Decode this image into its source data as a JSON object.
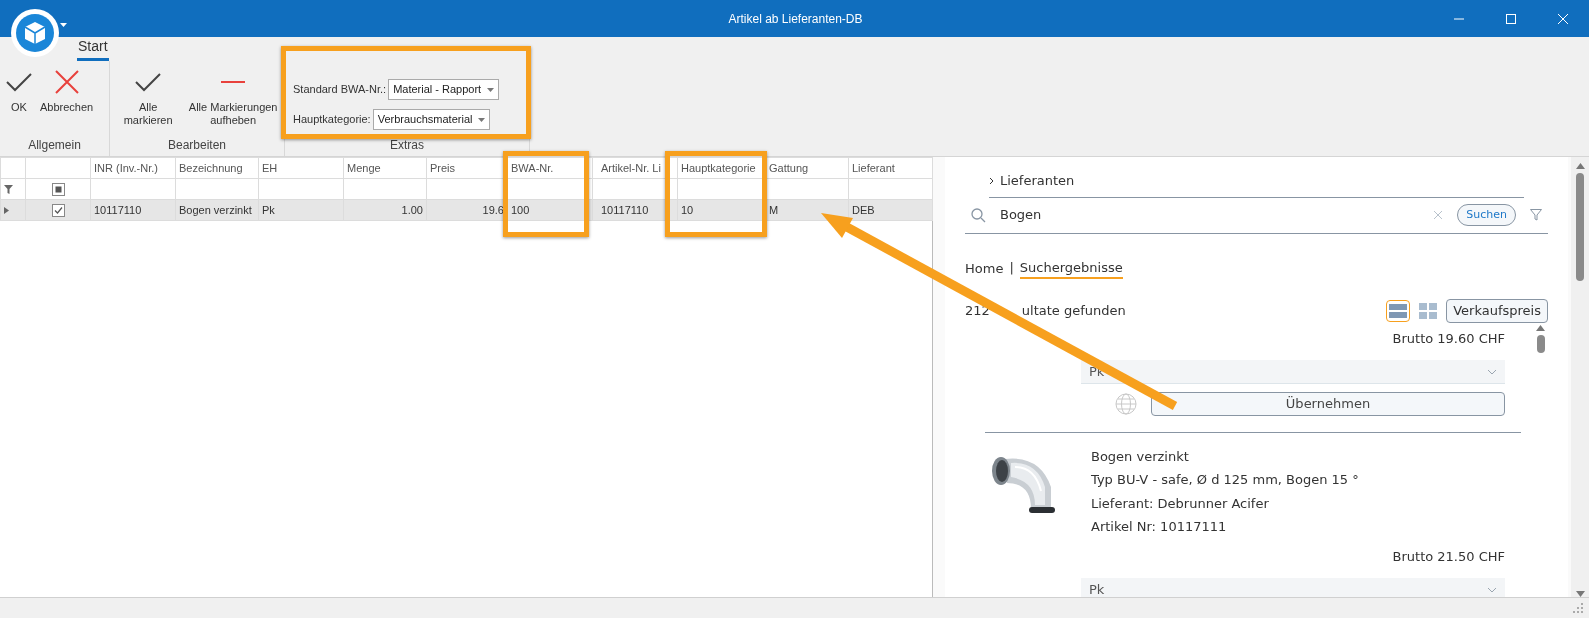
{
  "window": {
    "title": "Artikel ab Lieferanten-DB"
  },
  "ribbon": {
    "tabs": [
      {
        "label": "Start",
        "selected": true
      }
    ],
    "groups": [
      {
        "label": "Allgemein",
        "buttons": [
          {
            "label": "OK",
            "kind": "check"
          },
          {
            "label": "Abbrechen",
            "kind": "cross"
          }
        ]
      },
      {
        "label": "Bearbeiten",
        "buttons": [
          {
            "label": "Alle markieren",
            "kind": "check"
          },
          {
            "label": "Alle Markierungen aufheben",
            "kind": "dash"
          }
        ]
      },
      {
        "label": "Extras",
        "fields": [
          {
            "label": "Standard BWA-Nr.:",
            "value": "Material - Rapport"
          },
          {
            "label": "Hauptkategorie:",
            "value": "Verbrauchsmaterial"
          }
        ]
      }
    ]
  },
  "grid": {
    "columns": [
      "INR (Inv.-Nr.)",
      "Bezeichnung",
      "EH",
      "Menge",
      "Preis",
      "BWA-Nr.",
      "Artikel-Nr. Li",
      "Hauptkategorie",
      "Gattung",
      "Lieferant"
    ],
    "filter_checkbox": {
      "indeterminate": true
    },
    "rows": [
      {
        "selected": true,
        "checked": true,
        "cells": [
          "10117110",
          "Bogen verzinkt",
          "Pk",
          "1.00",
          "19.6",
          "100",
          "10117110",
          "10",
          "M",
          "DEB"
        ]
      }
    ]
  },
  "shop": {
    "section": "Lieferanten",
    "search": {
      "value": "Bogen",
      "button": "Suchen"
    },
    "breadcrumb_separator": "|",
    "breadcrumbs": [
      {
        "label": "Home",
        "selected": false
      },
      {
        "label": "Suchergebnisse",
        "selected": true
      }
    ],
    "result_count": [
      "212",
      "ultate gefunden"
    ],
    "views": [
      {
        "kind": "list",
        "selected": true
      },
      {
        "kind": "tiles",
        "selected": false
      }
    ],
    "price_mode": "Verkaufspreis",
    "items": [
      {
        "price": "Brutto 19.60 CHF",
        "unit": "Pk",
        "button": "Übernehmen"
      },
      {
        "kind": "picture",
        "title": "Bogen verzinkt",
        "lines": [
          "Typ BU-V - safe, Ø d 125 mm, Bogen 15 °",
          "Lieferant: Debrunner Acifer",
          "Artikel Nr: 10117111"
        ],
        "price": "Brutto 21.50 CHF",
        "unit": "Pk"
      }
    ]
  },
  "annotations": [
    {
      "kind": "frame"
    },
    {
      "kind": "frame"
    },
    {
      "kind": "frame"
    },
    {
      "kind": "arrow"
    }
  ]
}
